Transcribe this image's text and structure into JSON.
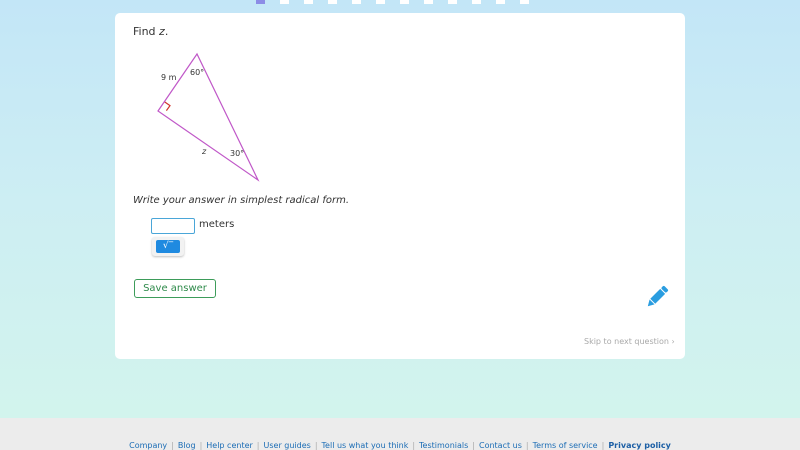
{
  "question": {
    "prompt_prefix": "Find ",
    "prompt_variable": "z",
    "prompt_suffix": ".",
    "triangle": {
      "side_label": "9 m",
      "hypotenuse_label": "z",
      "top_angle": "60°",
      "bottom_angle": "30°"
    },
    "instruction": "Write your answer in simplest radical form.",
    "answer_value": "",
    "unit": "meters",
    "sqrt_symbol": "√‾",
    "save_label": "Save answer",
    "skip_label": "Skip to next question ›"
  },
  "colors": {
    "triangle_stroke": "#c058c8",
    "right_angle_mark": "#d0342c",
    "accent_blue": "#1f8ae0",
    "save_green": "#2e8a4a",
    "pencil": "#2a9de0"
  },
  "footer": {
    "links": [
      "Company",
      "Blog",
      "Help center",
      "User guides",
      "Tell us what you think",
      "Testimonials",
      "Contact us",
      "Terms of service"
    ],
    "privacy_label": "Privacy policy"
  }
}
